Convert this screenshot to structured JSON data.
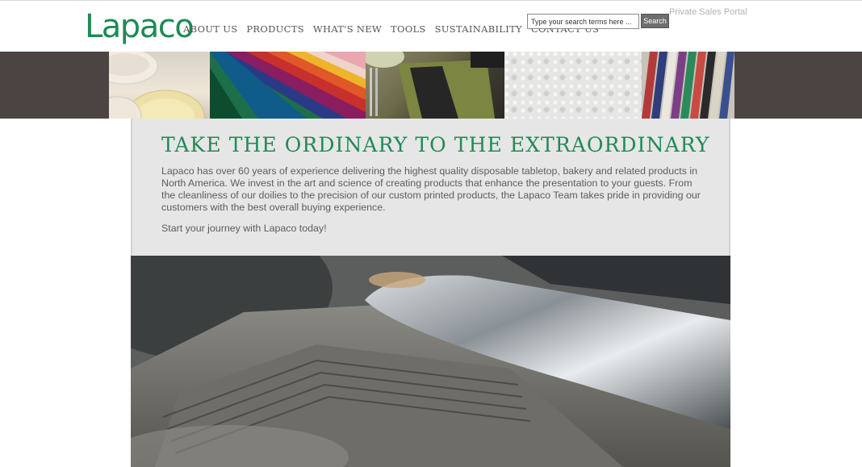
{
  "header": {
    "logo": "Lapaco",
    "nav": [
      {
        "label": "ABOUT US"
      },
      {
        "label": "PRODUCTS"
      },
      {
        "label": "WHAT'S NEW"
      },
      {
        "label": "TOOLS"
      },
      {
        "label": "SUSTAINABILITY"
      },
      {
        "label": "CONTACT US"
      }
    ],
    "search": {
      "placeholder": "Type your search terms here ...",
      "button_label": "Search"
    },
    "portal_link": "Private Sales Portal"
  },
  "intro": {
    "title": "TAKE THE ORDINARY TO THE EXTRAORDINARY",
    "body": "Lapaco has over 60 years of experience delivering the highest quality disposable tabletop, bakery and related products in North America.  We invest in the art and science of creating products that enhance the presentation to your guests.  From the cleanliness of our doilies to the precision of our custom printed products, the Lapaco Team takes pride in providing our customers with the best overall buying experience.",
    "cta": "Start your journey with Lapaco today!"
  },
  "colors": {
    "brand_green": "#1d8a57",
    "banner_bg": "#4b4443",
    "card_bg": "#e6e6e6",
    "text_gray": "#5d5d5d",
    "portal_gray": "#b2b2b2"
  }
}
